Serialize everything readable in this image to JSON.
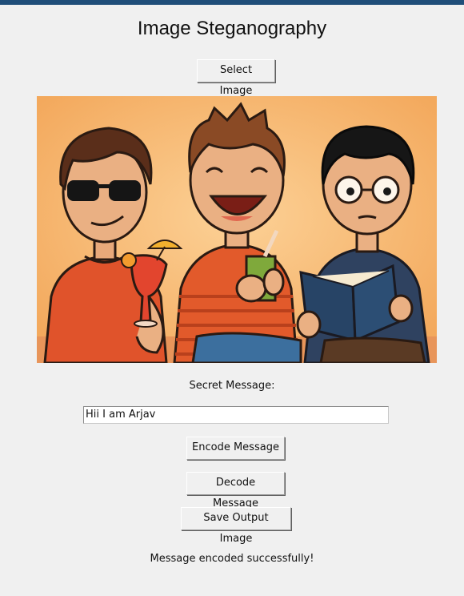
{
  "window": {
    "title": "Image Steganography",
    "accent_color": "#1f4e79"
  },
  "toolbar": {
    "select_image_label": "Select Image"
  },
  "preview": {
    "description_icon": "cartoon-image"
  },
  "secret": {
    "label": "Secret Message:",
    "value": "Hii I am Arjav"
  },
  "actions": {
    "encode_label": "Encode Message",
    "decode_label": "Decode Message",
    "save_label": "Save Output Image"
  },
  "status": {
    "text": "Message encoded successfully!"
  }
}
